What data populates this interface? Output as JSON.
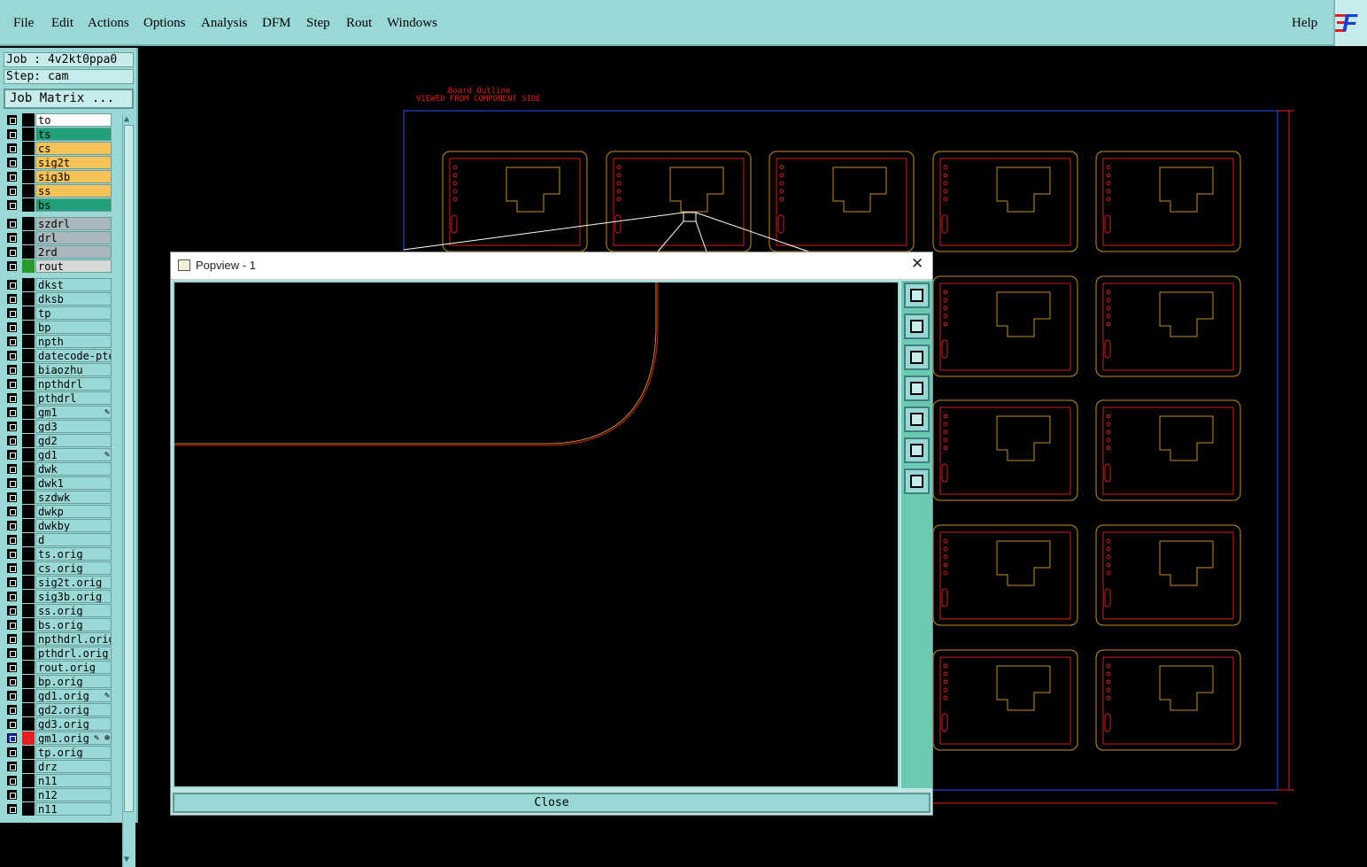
{
  "menubar": {
    "items": [
      "File",
      "Edit",
      "Actions",
      "Options",
      "Analysis",
      "DFM",
      "Step",
      "Rout",
      "Windows"
    ],
    "help": "Help"
  },
  "sidebar": {
    "job": "Job : 4v2kt0ppa0",
    "step": "Step: cam",
    "job_matrix": "Job Matrix ...",
    "layers": [
      {
        "name": "to",
        "color": "#000000",
        "bg": "#ffffff"
      },
      {
        "name": "ts",
        "color": "#000000",
        "bg": "#22a07a"
      },
      {
        "name": "cs",
        "color": "#000000",
        "bg": "#f8c258"
      },
      {
        "name": "sig2t",
        "color": "#000000",
        "bg": "#f8c258"
      },
      {
        "name": "sig3b",
        "color": "#000000",
        "bg": "#f8c258"
      },
      {
        "name": "ss",
        "color": "#000000",
        "bg": "#f8c258"
      },
      {
        "name": "bs",
        "color": "#000000",
        "bg": "#22a07a"
      },
      {
        "name": "szdrl",
        "color": "#000000",
        "bg": "#a8b8bc"
      },
      {
        "name": "drl",
        "color": "#000000",
        "bg": "#a8b8bc"
      },
      {
        "name": "2rd",
        "color": "#000000",
        "bg": "#a8b8bc"
      },
      {
        "name": "rout",
        "color": "#2a9a2a",
        "bg": "#d8d8d8"
      },
      {
        "name": "dkst",
        "color": "#000000",
        "bg": "#9ad8d6"
      },
      {
        "name": "dksb",
        "color": "#000000",
        "bg": "#9ad8d6"
      },
      {
        "name": "tp",
        "color": "#000000",
        "bg": "#9ad8d6"
      },
      {
        "name": "bp",
        "color": "#000000",
        "bg": "#9ad8d6"
      },
      {
        "name": "npth",
        "color": "#000000",
        "bg": "#9ad8d6"
      },
      {
        "name": "datecode-pte",
        "color": "#000000",
        "bg": "#9ad8d6"
      },
      {
        "name": "biaozhu",
        "color": "#000000",
        "bg": "#9ad8d6"
      },
      {
        "name": "npthdrl",
        "color": "#000000",
        "bg": "#9ad8d6"
      },
      {
        "name": "pthdrl",
        "color": "#000000",
        "bg": "#9ad8d6"
      },
      {
        "name": "gm1",
        "color": "#000000",
        "bg": "#9ad8d6",
        "extra": "✎"
      },
      {
        "name": "gd3",
        "color": "#000000",
        "bg": "#9ad8d6"
      },
      {
        "name": "gd2",
        "color": "#000000",
        "bg": "#9ad8d6"
      },
      {
        "name": "gd1",
        "color": "#000000",
        "bg": "#9ad8d6",
        "extra": "✎"
      },
      {
        "name": "dwk",
        "color": "#000000",
        "bg": "#9ad8d6"
      },
      {
        "name": "dwk1",
        "color": "#000000",
        "bg": "#9ad8d6"
      },
      {
        "name": "szdwk",
        "color": "#000000",
        "bg": "#9ad8d6"
      },
      {
        "name": "dwkp",
        "color": "#000000",
        "bg": "#9ad8d6"
      },
      {
        "name": "dwkby",
        "color": "#000000",
        "bg": "#9ad8d6"
      },
      {
        "name": "d",
        "color": "#000000",
        "bg": "#9ad8d6"
      },
      {
        "name": "ts.orig",
        "color": "#000000",
        "bg": "#9ad8d6"
      },
      {
        "name": "cs.orig",
        "color": "#000000",
        "bg": "#9ad8d6"
      },
      {
        "name": "sig2t.orig",
        "color": "#000000",
        "bg": "#9ad8d6"
      },
      {
        "name": "sig3b.orig",
        "color": "#000000",
        "bg": "#9ad8d6"
      },
      {
        "name": "ss.orig",
        "color": "#000000",
        "bg": "#9ad8d6"
      },
      {
        "name": "bs.orig",
        "color": "#000000",
        "bg": "#9ad8d6"
      },
      {
        "name": "npthdrl.orig",
        "color": "#000000",
        "bg": "#9ad8d6"
      },
      {
        "name": "pthdrl.orig",
        "color": "#000000",
        "bg": "#9ad8d6"
      },
      {
        "name": "rout.orig",
        "color": "#000000",
        "bg": "#9ad8d6"
      },
      {
        "name": "bp.orig",
        "color": "#000000",
        "bg": "#9ad8d6"
      },
      {
        "name": "gd1.orig",
        "color": "#000000",
        "bg": "#9ad8d6",
        "extra": "✎"
      },
      {
        "name": "gd2.orig",
        "color": "#000000",
        "bg": "#9ad8d6"
      },
      {
        "name": "gd3.orig",
        "color": "#000000",
        "bg": "#9ad8d6"
      },
      {
        "name": "gm1.orig",
        "color": "#e02020",
        "bg": "#9ad8d6",
        "extra": "✎ ⊕",
        "active": true
      },
      {
        "name": "tp.orig",
        "color": "#000000",
        "bg": "#9ad8d6"
      },
      {
        "name": "drz",
        "color": "#000000",
        "bg": "#9ad8d6"
      },
      {
        "name": "n11",
        "color": "#000000",
        "bg": "#9ad8d6"
      },
      {
        "name": "n12",
        "color": "#000000",
        "bg": "#9ad8d6"
      },
      {
        "name": "n11",
        "color": "#000000",
        "bg": "#9ad8d6"
      }
    ]
  },
  "canvas": {
    "annotation_line1": "Board Outline",
    "annotation_line2": "VIEWED FROM COMPONENT SIDE",
    "colors": {
      "board": "#3050ff",
      "part": "#c89028",
      "pad": "#d02020",
      "dim": "#e02020"
    }
  },
  "popup": {
    "title": "Popview - 1",
    "close_x": "✕",
    "close_button": "Close",
    "tools": [
      "zoom-home-icon",
      "pan-up-icon",
      "pan-down-icon",
      "pan-left-icon",
      "pan-right-icon",
      "zoom-in-icon",
      "zoom-out-icon"
    ]
  }
}
